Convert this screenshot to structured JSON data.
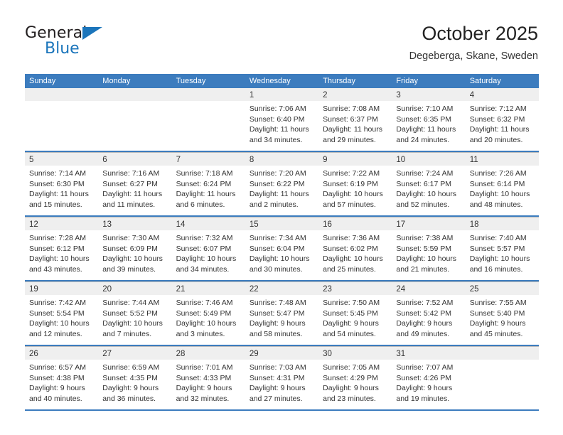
{
  "brand": {
    "name_top": "General",
    "name_bottom": "Blue",
    "triangle_icon": "triangle-icon",
    "accent_color": "#1b75bb"
  },
  "header": {
    "title": "October 2025",
    "subtitle": "Degeberga, Skane, Sweden"
  },
  "theme": {
    "header_blue": "#3c7cbe",
    "day_band_gray": "#efefef",
    "cell_border": "#bcbcbc",
    "text": "#333333"
  },
  "calendar": {
    "weekday_headers": [
      "Sunday",
      "Monday",
      "Tuesday",
      "Wednesday",
      "Thursday",
      "Friday",
      "Saturday"
    ],
    "weeks": [
      [
        {
          "day": "",
          "sunrise": "",
          "sunset": "",
          "daylight1": "",
          "daylight2": ""
        },
        {
          "day": "",
          "sunrise": "",
          "sunset": "",
          "daylight1": "",
          "daylight2": ""
        },
        {
          "day": "",
          "sunrise": "",
          "sunset": "",
          "daylight1": "",
          "daylight2": ""
        },
        {
          "day": "1",
          "sunrise": "Sunrise: 7:06 AM",
          "sunset": "Sunset: 6:40 PM",
          "daylight1": "Daylight: 11 hours",
          "daylight2": "and 34 minutes."
        },
        {
          "day": "2",
          "sunrise": "Sunrise: 7:08 AM",
          "sunset": "Sunset: 6:37 PM",
          "daylight1": "Daylight: 11 hours",
          "daylight2": "and 29 minutes."
        },
        {
          "day": "3",
          "sunrise": "Sunrise: 7:10 AM",
          "sunset": "Sunset: 6:35 PM",
          "daylight1": "Daylight: 11 hours",
          "daylight2": "and 24 minutes."
        },
        {
          "day": "4",
          "sunrise": "Sunrise: 7:12 AM",
          "sunset": "Sunset: 6:32 PM",
          "daylight1": "Daylight: 11 hours",
          "daylight2": "and 20 minutes."
        }
      ],
      [
        {
          "day": "5",
          "sunrise": "Sunrise: 7:14 AM",
          "sunset": "Sunset: 6:30 PM",
          "daylight1": "Daylight: 11 hours",
          "daylight2": "and 15 minutes."
        },
        {
          "day": "6",
          "sunrise": "Sunrise: 7:16 AM",
          "sunset": "Sunset: 6:27 PM",
          "daylight1": "Daylight: 11 hours",
          "daylight2": "and 11 minutes."
        },
        {
          "day": "7",
          "sunrise": "Sunrise: 7:18 AM",
          "sunset": "Sunset: 6:24 PM",
          "daylight1": "Daylight: 11 hours",
          "daylight2": "and 6 minutes."
        },
        {
          "day": "8",
          "sunrise": "Sunrise: 7:20 AM",
          "sunset": "Sunset: 6:22 PM",
          "daylight1": "Daylight: 11 hours",
          "daylight2": "and 2 minutes."
        },
        {
          "day": "9",
          "sunrise": "Sunrise: 7:22 AM",
          "sunset": "Sunset: 6:19 PM",
          "daylight1": "Daylight: 10 hours",
          "daylight2": "and 57 minutes."
        },
        {
          "day": "10",
          "sunrise": "Sunrise: 7:24 AM",
          "sunset": "Sunset: 6:17 PM",
          "daylight1": "Daylight: 10 hours",
          "daylight2": "and 52 minutes."
        },
        {
          "day": "11",
          "sunrise": "Sunrise: 7:26 AM",
          "sunset": "Sunset: 6:14 PM",
          "daylight1": "Daylight: 10 hours",
          "daylight2": "and 48 minutes."
        }
      ],
      [
        {
          "day": "12",
          "sunrise": "Sunrise: 7:28 AM",
          "sunset": "Sunset: 6:12 PM",
          "daylight1": "Daylight: 10 hours",
          "daylight2": "and 43 minutes."
        },
        {
          "day": "13",
          "sunrise": "Sunrise: 7:30 AM",
          "sunset": "Sunset: 6:09 PM",
          "daylight1": "Daylight: 10 hours",
          "daylight2": "and 39 minutes."
        },
        {
          "day": "14",
          "sunrise": "Sunrise: 7:32 AM",
          "sunset": "Sunset: 6:07 PM",
          "daylight1": "Daylight: 10 hours",
          "daylight2": "and 34 minutes."
        },
        {
          "day": "15",
          "sunrise": "Sunrise: 7:34 AM",
          "sunset": "Sunset: 6:04 PM",
          "daylight1": "Daylight: 10 hours",
          "daylight2": "and 30 minutes."
        },
        {
          "day": "16",
          "sunrise": "Sunrise: 7:36 AM",
          "sunset": "Sunset: 6:02 PM",
          "daylight1": "Daylight: 10 hours",
          "daylight2": "and 25 minutes."
        },
        {
          "day": "17",
          "sunrise": "Sunrise: 7:38 AM",
          "sunset": "Sunset: 5:59 PM",
          "daylight1": "Daylight: 10 hours",
          "daylight2": "and 21 minutes."
        },
        {
          "day": "18",
          "sunrise": "Sunrise: 7:40 AM",
          "sunset": "Sunset: 5:57 PM",
          "daylight1": "Daylight: 10 hours",
          "daylight2": "and 16 minutes."
        }
      ],
      [
        {
          "day": "19",
          "sunrise": "Sunrise: 7:42 AM",
          "sunset": "Sunset: 5:54 PM",
          "daylight1": "Daylight: 10 hours",
          "daylight2": "and 12 minutes."
        },
        {
          "day": "20",
          "sunrise": "Sunrise: 7:44 AM",
          "sunset": "Sunset: 5:52 PM",
          "daylight1": "Daylight: 10 hours",
          "daylight2": "and 7 minutes."
        },
        {
          "day": "21",
          "sunrise": "Sunrise: 7:46 AM",
          "sunset": "Sunset: 5:49 PM",
          "daylight1": "Daylight: 10 hours",
          "daylight2": "and 3 minutes."
        },
        {
          "day": "22",
          "sunrise": "Sunrise: 7:48 AM",
          "sunset": "Sunset: 5:47 PM",
          "daylight1": "Daylight: 9 hours",
          "daylight2": "and 58 minutes."
        },
        {
          "day": "23",
          "sunrise": "Sunrise: 7:50 AM",
          "sunset": "Sunset: 5:45 PM",
          "daylight1": "Daylight: 9 hours",
          "daylight2": "and 54 minutes."
        },
        {
          "day": "24",
          "sunrise": "Sunrise: 7:52 AM",
          "sunset": "Sunset: 5:42 PM",
          "daylight1": "Daylight: 9 hours",
          "daylight2": "and 49 minutes."
        },
        {
          "day": "25",
          "sunrise": "Sunrise: 7:55 AM",
          "sunset": "Sunset: 5:40 PM",
          "daylight1": "Daylight: 9 hours",
          "daylight2": "and 45 minutes."
        }
      ],
      [
        {
          "day": "26",
          "sunrise": "Sunrise: 6:57 AM",
          "sunset": "Sunset: 4:38 PM",
          "daylight1": "Daylight: 9 hours",
          "daylight2": "and 40 minutes."
        },
        {
          "day": "27",
          "sunrise": "Sunrise: 6:59 AM",
          "sunset": "Sunset: 4:35 PM",
          "daylight1": "Daylight: 9 hours",
          "daylight2": "and 36 minutes."
        },
        {
          "day": "28",
          "sunrise": "Sunrise: 7:01 AM",
          "sunset": "Sunset: 4:33 PM",
          "daylight1": "Daylight: 9 hours",
          "daylight2": "and 32 minutes."
        },
        {
          "day": "29",
          "sunrise": "Sunrise: 7:03 AM",
          "sunset": "Sunset: 4:31 PM",
          "daylight1": "Daylight: 9 hours",
          "daylight2": "and 27 minutes."
        },
        {
          "day": "30",
          "sunrise": "Sunrise: 7:05 AM",
          "sunset": "Sunset: 4:29 PM",
          "daylight1": "Daylight: 9 hours",
          "daylight2": "and 23 minutes."
        },
        {
          "day": "31",
          "sunrise": "Sunrise: 7:07 AM",
          "sunset": "Sunset: 4:26 PM",
          "daylight1": "Daylight: 9 hours",
          "daylight2": "and 19 minutes."
        },
        {
          "day": "",
          "sunrise": "",
          "sunset": "",
          "daylight1": "",
          "daylight2": ""
        }
      ]
    ]
  }
}
